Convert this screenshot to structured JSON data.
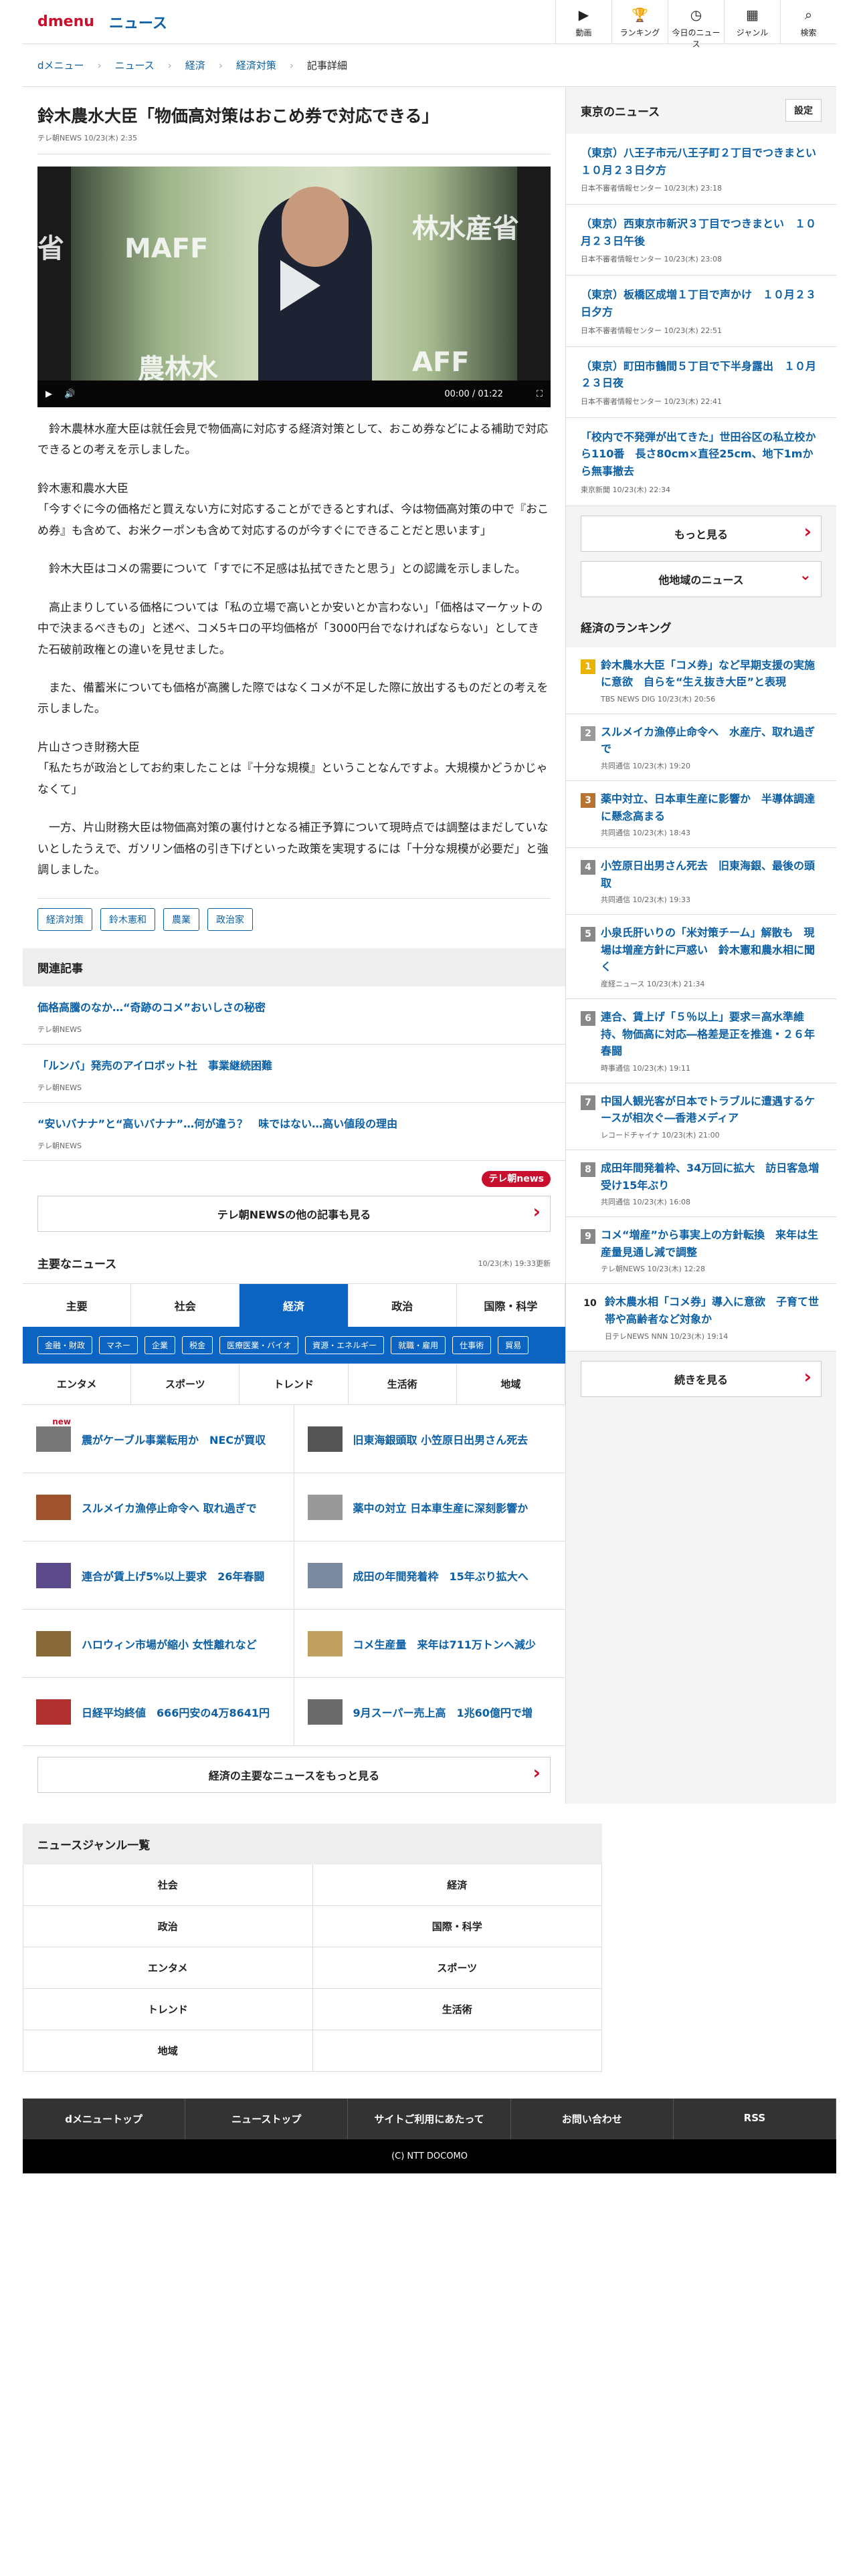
{
  "header": {
    "brand": "dmenu",
    "section": "ニュース",
    "nav": [
      {
        "icon": "video-icon",
        "glyph": "▶",
        "label": "動画"
      },
      {
        "icon": "trophy-icon",
        "glyph": "🏆",
        "label": "ランキング"
      },
      {
        "icon": "clock-icon",
        "glyph": "◷",
        "label": "今日のニュース"
      },
      {
        "icon": "grid-icon",
        "glyph": "▦",
        "label": "ジャンル"
      },
      {
        "icon": "search-icon",
        "glyph": "⌕",
        "label": "検索"
      }
    ]
  },
  "breadcrumb": [
    "dメニュー",
    "ニュース",
    "経済",
    "経済対策",
    "記事詳細"
  ],
  "article": {
    "title": "鈴木農水大臣「物価高対策はおこめ券で対応できる」",
    "meta": "テレ朝NEWS 10/23(木) 2:35",
    "video": {
      "time": "00:00 / 01:22",
      "t1": "省",
      "t2": "MAFF",
      "t3": "林水産省",
      "t4": "農林水",
      "t5": "AFF"
    },
    "paragraphs": [
      "　鈴木農林水産大臣は就任会見で物価高に対応する経済対策として、おこめ券などによる補助で対応できるとの考えを示しました。",
      "鈴木憲和農水大臣\n「今すぐに今の価格だと買えない方に対応することができるとすれば、今は物価高対策の中で『おこめ券』も含めて、お米クーポンも含めて対応するのが今すぐにできることだと思います」",
      "　鈴木大臣はコメの需要について「すでに不足感は払拭できたと思う」との認識を示しました。",
      "　高止まりしている価格については「私の立場で高いとか安いとか言わない」「価格はマーケットの中で決まるべきもの」と述べ、コメ5キロの平均価格が「3000円台でなければならない」としてきた石破前政権との違いを見せました。",
      "　また、備蓄米についても価格が高騰した際ではなくコメが不足した際に放出するものだとの考えを示しました。",
      "片山さつき財務大臣\n「私たちが政治としてお約束したことは『十分な規模』ということなんですよ。大規模かどうかじゃなくて」",
      "　一方、片山財務大臣は物価高対策の裏付けとなる補正予算について現時点では調整はまだしていないとしたうえで、ガソリン価格の引き下げといった政策を実現するには「十分な規模が必要だ」と強調しました。"
    ],
    "tags": [
      "経済対策",
      "鈴木憲和",
      "農業",
      "政治家"
    ]
  },
  "related": {
    "heading": "関連記事",
    "items": [
      {
        "title": "価格高騰のなか…“奇跡のコメ”おいしさの秘密",
        "src": "テレ朝NEWS"
      },
      {
        "title": "「ルンバ」発売のアイロボット社　事業継続困難",
        "src": "テレ朝NEWS"
      },
      {
        "title": "“安いバナナ”と“高いバナナ”…何が違う？　味ではない…高い値段の理由",
        "src": "テレ朝NEWS"
      }
    ],
    "logo": "テレ朝news",
    "more": "テレ朝NEWSの他の記事も見る"
  },
  "major": {
    "heading": "主要なニュース",
    "updated": "10/23(木) 19:33更新",
    "tabs": [
      "主要",
      "社会",
      "経済",
      "政治",
      "国際・科学"
    ],
    "subtags": [
      "金融・財政",
      "マネー",
      "企業",
      "税金",
      "医療医業・バイオ",
      "資源・エネルギー",
      "就職・雇用",
      "仕事術",
      "貿易"
    ],
    "tabs2": [
      "エンタメ",
      "スポーツ",
      "トレンド",
      "生活術",
      "地域"
    ],
    "items": [
      {
        "title": "震がケーブル事業転用か　NECが買収",
        "new": "new"
      },
      {
        "title": "旧東海銀頭取 小笠原日出男さん死去",
        "new": ""
      },
      {
        "title": "スルメイカ漁停止命令へ 取れ過ぎで",
        "new": ""
      },
      {
        "title": "薬中の対立 日本車生産に深刻影響か",
        "new": ""
      },
      {
        "title": "連合が賃上げ5%以上要求　26年春闘",
        "new": ""
      },
      {
        "title": "成田の年間発着枠　15年ぶり拡大へ",
        "new": ""
      },
      {
        "title": "ハロウィン市場が縮小 女性離れなど",
        "new": ""
      },
      {
        "title": "コメ生産量　来年は711万トンへ減少",
        "new": ""
      },
      {
        "title": "日経平均終値　666円安の4万8641円",
        "new": ""
      },
      {
        "title": "9月スーパー売上高　1兆60億円で増",
        "new": ""
      }
    ],
    "more": "経済の主要なニュースをもっと見る"
  },
  "local": {
    "heading": "東京のニュース",
    "settings": "設定",
    "items": [
      {
        "title": "（東京）八王子市元八王子町２丁目でつきまとい　１０月２３日夕方",
        "src": "日本不審者情報センター 10/23(木) 23:18"
      },
      {
        "title": "（東京）西東京市新沢３丁目でつきまとい　１０月２３日午後",
        "src": "日本不審者情報センター 10/23(木) 23:08"
      },
      {
        "title": "（東京）板橋区成増１丁目で声かけ　１０月２３日夕方",
        "src": "日本不審者情報センター 10/23(木) 22:51"
      },
      {
        "title": "（東京）町田市鶴間５丁目で下半身露出　１０月２３日夜",
        "src": "日本不審者情報センター 10/23(木) 22:41"
      },
      {
        "title": "「校内で不発弾が出てきた」世田谷区の私立校から110番　長さ80cm×直径25cm、地下1mから無事撤去",
        "src": "東京新聞 10/23(木) 22:34"
      }
    ],
    "more": "もっと見る",
    "other": "他地域のニュース"
  },
  "ranking": {
    "heading": "経済のランキング",
    "items": [
      {
        "n": "1",
        "c": "#e8b400",
        "title": "鈴木農水大臣「コメ券」など早期支援の実施に意欲　自らを“生え抜き大臣”と表現",
        "src": "TBS NEWS DIG 10/23(木) 20:56"
      },
      {
        "n": "2",
        "c": "#999",
        "title": "スルメイカ漁停止命令へ　水産庁、取れ過ぎで",
        "src": "共同通信 10/23(木) 19:20"
      },
      {
        "n": "3",
        "c": "#b87333",
        "title": "薬中対立、日本車生産に影響か　半導体調達に懸念高まる",
        "src": "共同通信 10/23(木) 18:43"
      },
      {
        "n": "4",
        "c": "#888",
        "title": "小笠原日出男さん死去　旧東海銀、最後の頭取",
        "src": "共同通信 10/23(木) 19:33"
      },
      {
        "n": "5",
        "c": "#888",
        "title": "小泉氏肝いりの「米対策チーム」解散も　現場は増産方針に戸惑い　鈴木憲和農水相に聞く",
        "src": "産経ニュース 10/23(木) 21:34"
      },
      {
        "n": "6",
        "c": "#888",
        "title": "連合、賃上げ「５％以上」要求＝高水準維持、物価高に対応―格差是正を推進・２６年春闘",
        "src": "時事通信 10/23(木) 19:11"
      },
      {
        "n": "7",
        "c": "#888",
        "title": "中国人観光客が日本でトラブルに遭遇するケースが相次ぐ―香港メディア",
        "src": "レコードチャイナ 10/23(木) 21:00"
      },
      {
        "n": "8",
        "c": "#888",
        "title": "成田年間発着枠、34万回に拡大　訪日客急増受け15年ぶり",
        "src": "共同通信 10/23(木) 16:08"
      },
      {
        "n": "9",
        "c": "#888",
        "title": "コメ“増産”から事実上の方針転換　来年は生産量見通し減で調整",
        "src": "テレ朝NEWS 10/23(木) 12:28"
      },
      {
        "n": "10",
        "c": "#888",
        "title": "鈴木農水相「コメ券」導入に意欲　子育て世帯や高齢者など対象か",
        "src": "日テレNEWS NNN 10/23(木) 19:14"
      }
    ],
    "more": "続きを見る"
  },
  "genres": {
    "heading": "ニュースジャンル一覧",
    "items": [
      "社会",
      "経済",
      "政治",
      "国際・科学",
      "エンタメ",
      "スポーツ",
      "トレンド",
      "生活術",
      "地域",
      ""
    ]
  },
  "footer": {
    "links": [
      "dメニュートップ",
      "ニューストップ",
      "サイトご利用にあたって",
      "お問い合わせ",
      "RSS"
    ],
    "copyright": "(C) NTT DOCOMO"
  }
}
